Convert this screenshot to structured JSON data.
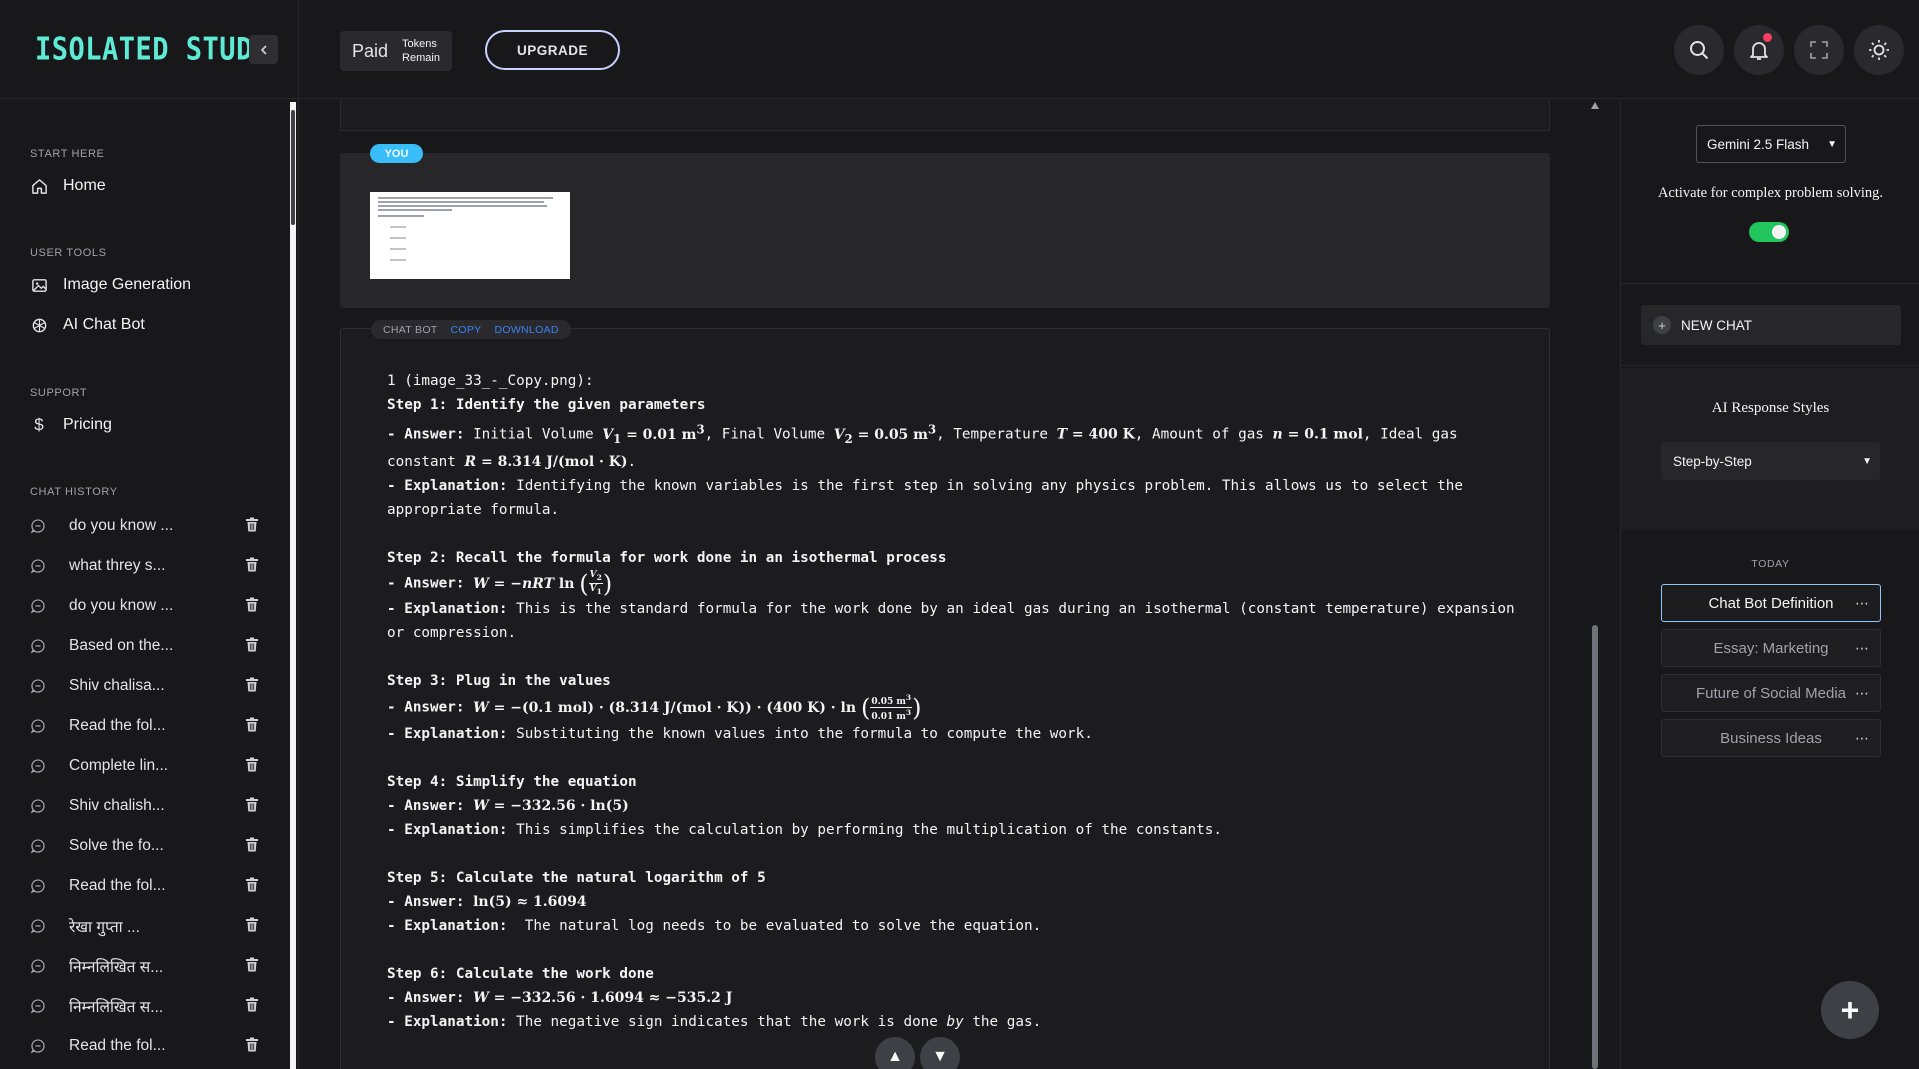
{
  "app": {
    "brand": "ISOLATED STUDY",
    "collapse_icon": "chevron-left-icon"
  },
  "sidebar": {
    "sections": [
      {
        "title": "START HERE",
        "items": [
          {
            "label": "Home",
            "icon": "home-icon"
          }
        ]
      },
      {
        "title": "USER TOOLS",
        "items": [
          {
            "label": "Image Generation",
            "icon": "image-icon"
          },
          {
            "label": "AI Chat Bot",
            "icon": "openai-icon"
          }
        ]
      },
      {
        "title": "SUPPORT",
        "items": [
          {
            "label": "Pricing",
            "icon": "dollar-icon"
          }
        ]
      }
    ],
    "history_title": "CHAT HISTORY",
    "history": [
      "do you know ...",
      "what threy s...",
      "do you know ...",
      "Based on the...",
      "Shiv chalisa...",
      "Read the fol...",
      "Complete lin...",
      "Shiv chalish...",
      "Solve the fo...",
      "Read the fol...",
      "रेखा गुप्ता ...",
      "निम्नलिखित स...",
      "निम्नलिखित स...",
      "Read the fol..."
    ]
  },
  "topbar": {
    "plan": "Paid",
    "tokens_line1": "Tokens",
    "tokens_line2": "Remain",
    "upgrade": "UPGRADE",
    "icons": [
      "search-icon",
      "bell-icon",
      "fullscreen-icon",
      "sun-icon"
    ],
    "notification_color": "#f43f5e"
  },
  "chat": {
    "user_tag": "YOU",
    "bot_tag": "CHAT BOT",
    "copy": "COPY",
    "download": "DOWNLOAD",
    "file_line": "1 (image_33_-_Copy.png):",
    "steps": [
      {
        "title": "Step 1: Identify the given parameters",
        "answer_label": "- Answer:",
        "answer": "Initial Volume V₁ = 0.01 m³, Final Volume V₂ = 0.05 m³, Temperature T = 400 K, Amount of gas n = 0.1 mol, Ideal gas constant R = 8.314 J/(mol·K).",
        "explanation_label": "- Explanation:",
        "explanation": "Identifying the known variables is the first step in solving any physics problem. This allows us to select the appropriate formula."
      },
      {
        "title": "Step 2: Recall the formula for work done in an isothermal process",
        "answer_label": "- Answer:",
        "answer": "W = −nRT ln (V₂/V₁)",
        "explanation_label": "- Explanation:",
        "explanation": "This is the standard formula for the work done by an ideal gas during an isothermal (constant temperature) expansion or compression."
      },
      {
        "title": "Step 3: Plug in the values",
        "answer_label": "- Answer:",
        "answer": "W = −(0.1 mol)·(8.314 J/(mol·K))·(400 K)·ln (0.05 m³/0.01 m³)",
        "explanation_label": "- Explanation:",
        "explanation": "Substituting the known values into the formula to compute the work."
      },
      {
        "title": "Step 4: Simplify the equation",
        "answer_label": "- Answer:",
        "answer": "W = −332.56 · ln(5)",
        "explanation_label": "- Explanation:",
        "explanation": "This simplifies the calculation by performing the multiplication of the constants."
      },
      {
        "title": "Step 5: Calculate the natural logarithm of 5",
        "answer_label": "- Answer:",
        "answer": "ln(5) ≈ 1.6094",
        "explanation_label": "- Explanation:",
        "explanation": " The natural log needs to be evaluated to solve the equation."
      },
      {
        "title": "Step 6: Calculate the work done",
        "answer_label": "- Answer:",
        "answer": "W = −332.56 · 1.6094 ≈ −535.2 J",
        "explanation_label": "- Explanation:",
        "explanation": "The negative sign indicates that the work is done by the gas."
      }
    ]
  },
  "right_panel": {
    "model": "Gemini 2.5 Flash",
    "activate_text": "Activate for complex problem solving.",
    "toggle_on": true,
    "new_chat": "NEW CHAT",
    "styles_title": "AI Response Styles",
    "style_value": "Step-by-Step",
    "today": "TODAY",
    "conversations": [
      "Chat Bot Definition",
      "Essay: Marketing",
      "Future of Social Media",
      "Business Ideas"
    ]
  },
  "colors": {
    "accent_teal": "#5eead4",
    "you_tag": "#38bdf8",
    "link_blue": "#3b82f6",
    "toggle_green": "#22c55e"
  }
}
